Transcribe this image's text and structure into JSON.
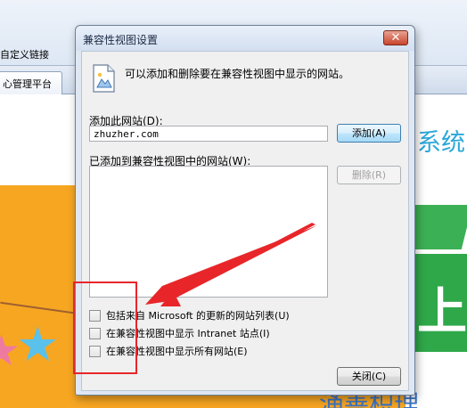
{
  "background": {
    "favorites_link": "自定义链接",
    "tab_label": "心管理平台",
    "right_title": "系统",
    "big_char": "上",
    "bottom_title": "涌善枳理"
  },
  "dialog": {
    "title": "兼容性视图设置",
    "close_glyph": "✕",
    "info_text": "可以添加和删除要在兼容性视图中显示的网站。",
    "add_label": "添加此网站(D):",
    "url_value": "zhuzher.com",
    "add_button": "添加(A)",
    "list_label": "已添加到兼容性视图中的网站(W):",
    "sites": [],
    "remove_button": "删除(R)",
    "checkboxes": [
      {
        "label": "包括来自 Microsoft 的更新的网站列表(U)",
        "checked": false
      },
      {
        "label": "在兼容性视图中显示 Intranet 站点(I)",
        "checked": false
      },
      {
        "label": "在兼容性视图中显示所有网站(E)",
        "checked": false
      }
    ],
    "close_button": "关闭(C)"
  },
  "colors": {
    "annotation": "#e8262a",
    "close_button": "#c8452c",
    "orange_bg": "#f7a622",
    "green_bg": "#2fa84a"
  },
  "icons": {
    "info": "picture-icon",
    "annotation_arrow": "arrow-icon"
  }
}
